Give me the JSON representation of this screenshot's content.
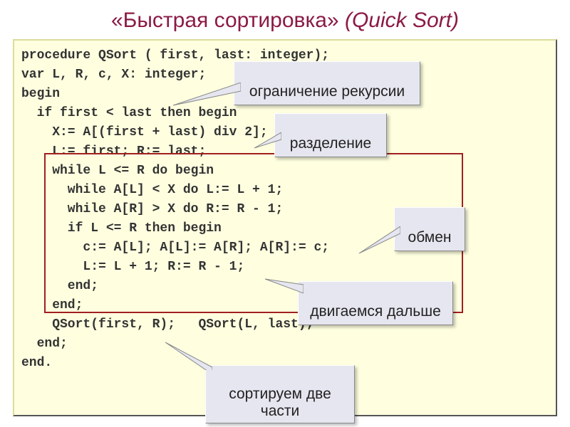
{
  "title": {
    "prefix": "«Быстрая сортировка»",
    "suffix": "(Quick Sort)"
  },
  "code": {
    "l1": "procedure QSort ( first, last: integer);",
    "l2": "var L, R, c, X: integer;",
    "l3": "begin",
    "l4": "  if first < last then begin",
    "l5": "    X:= A[(first + last) div 2];",
    "l6": "    L:= first; R:= last;",
    "l7": "    while L <= R do begin",
    "l8": "      while A[L] < X do L:= L + 1;",
    "l9": "      while A[R] > X do R:= R - 1;",
    "l10": "      if L <= R then begin",
    "l11": "        c:= A[L]; A[L]:= A[R]; A[R]:= c;",
    "l12": "        L:= L + 1; R:= R - 1;",
    "l13": "      end;",
    "l14": "    end;",
    "l15": "    QSort(first, R);   QSort(L, last);",
    "l16": "  end;",
    "l17": "end."
  },
  "callouts": {
    "c1": "ограничение рекурсии",
    "c2": "разделение",
    "c3": "обмен",
    "c4": "двигаемся дальше",
    "c5": "сортируем две\nчасти"
  },
  "colors": {
    "title": "#8b1a45",
    "code_bg": "#ffffe0",
    "callout_bg": "#e6e6f0",
    "highlight_border": "#a02020"
  }
}
